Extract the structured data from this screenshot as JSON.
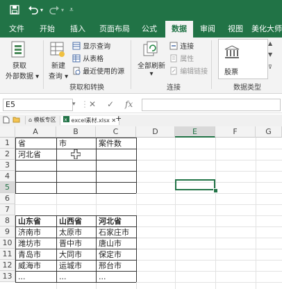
{
  "titlebar": {
    "save_icon": "save-icon",
    "undo_icon": "undo-icon",
    "redo_icon": "redo-icon",
    "customize_icon": "customize-qat-icon"
  },
  "ribbon_tabs": [
    "文件",
    "开始",
    "插入",
    "页面布局",
    "公式",
    "数据",
    "审阅",
    "视图",
    "美化大师"
  ],
  "active_tab": "数据",
  "ribbon": {
    "get_external_line1": "获取",
    "get_external_line2": "外部数据 ▾",
    "new_query_line1": "新建",
    "new_query_line2": "查询 ▾",
    "show_queries": "显示查询",
    "from_table": "从表格",
    "recent_sources": "最近使用的源",
    "group_get_transform": "获取和转换",
    "refresh_all_line1": "全部刷新",
    "refresh_all_line2": "▾",
    "connections": "连接",
    "properties": "属性",
    "edit_links": "编辑链接",
    "group_connections": "连接",
    "stocks": "股票",
    "group_data_types": "数据类型"
  },
  "formula_bar": {
    "name_box": "E5",
    "cancel": "✕",
    "enter": "✓",
    "fx": "fx",
    "value": ""
  },
  "tabstrip": {
    "template_zone": "模板专区",
    "workbook": "excel素材.xlsx",
    "close": "✕",
    "add": "+"
  },
  "columns": [
    "A",
    "B",
    "C",
    "D",
    "E",
    "F",
    "G"
  ],
  "selected_column": "E",
  "rows": [
    "1",
    "2",
    "3",
    "4",
    "5",
    "6",
    "7",
    "8",
    "9",
    "10",
    "11",
    "12",
    "13"
  ],
  "cells": {
    "A1": "省",
    "B1": "市",
    "C1": "案件数",
    "A2": "河北省",
    "A8": "山东省",
    "B8": "山西省",
    "C8": "河北省",
    "A9": "济南市",
    "B9": "太原市",
    "C9": "石家庄市",
    "A10": "潍坊市",
    "B10": "晋中市",
    "C10": "唐山市",
    "A11": "青岛市",
    "B11": "大同市",
    "C11": "保定市",
    "A12": "威海市",
    "B12": "运城市",
    "C12": "邢台市",
    "A13": "...",
    "B13": "...",
    "C13": "..."
  },
  "active_cell": "E5",
  "cursor_icon": "cell-cursor-icon"
}
